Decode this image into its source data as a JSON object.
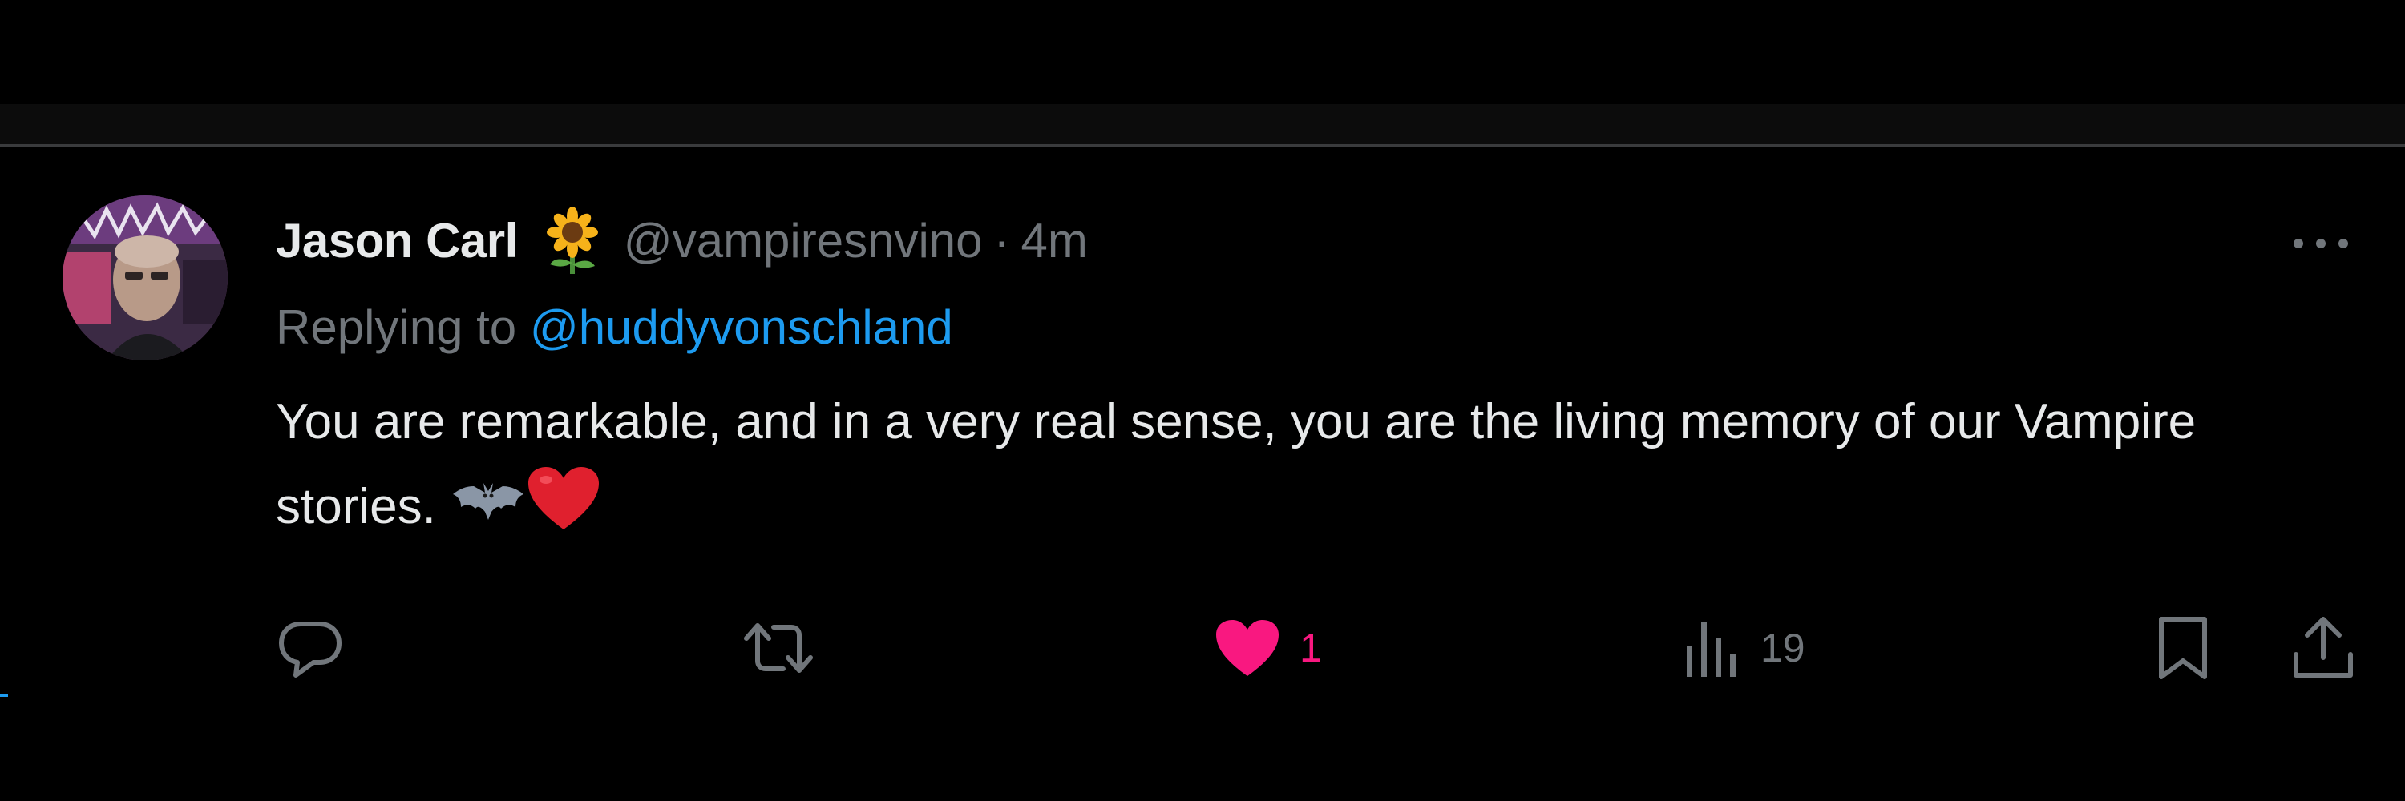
{
  "tweet": {
    "author": {
      "display_name": "Jason Carl",
      "badge_icon": "sunflower-emoji",
      "handle": "@vampiresnvino"
    },
    "separator": "·",
    "timestamp": "4m",
    "reply": {
      "prefix": "Replying to ",
      "mention": "@huddyvonschland"
    },
    "text": "You are remarkable, and in a very real sense, you are the living memory of our Vampire stories.",
    "emojis": [
      "bat-emoji",
      "red-heart-emoji"
    ],
    "actions": {
      "reply": {
        "icon": "reply-icon"
      },
      "retweet": {
        "icon": "retweet-icon"
      },
      "like": {
        "icon": "heart-filled-icon",
        "count": "1",
        "liked": true
      },
      "views": {
        "icon": "bar-chart-icon",
        "count": "19"
      },
      "bookmark": {
        "icon": "bookmark-icon"
      },
      "share": {
        "icon": "share-icon"
      }
    },
    "more_icon": "more-horizontal-icon"
  },
  "colors": {
    "background": "#000000",
    "text_primary": "#e7e9ea",
    "text_secondary": "#71767b",
    "link_blue": "#1d9bf0",
    "like_pink": "#f91880",
    "divider": "#3a3b3d"
  }
}
